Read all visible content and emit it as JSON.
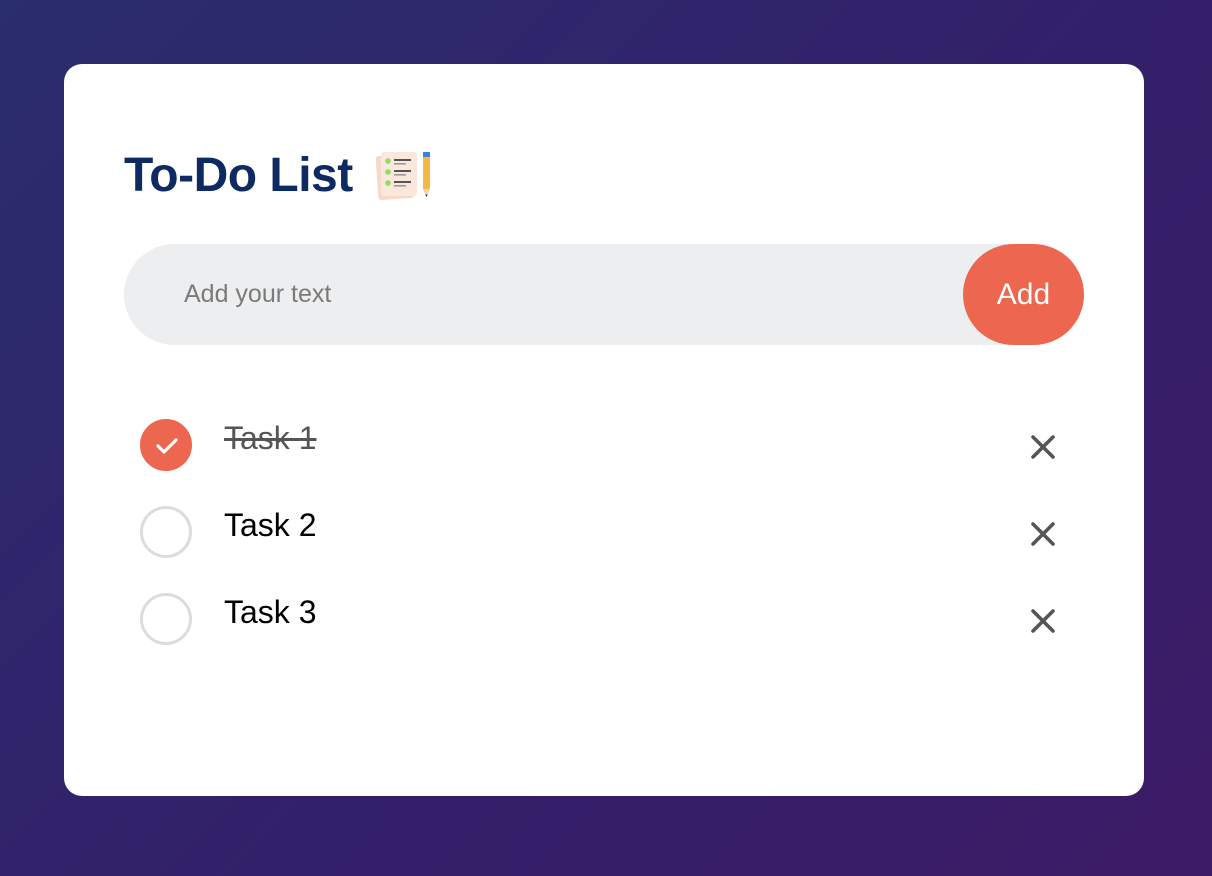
{
  "header": {
    "title": "To-Do List",
    "icon": "checklist-notepad-pencil-icon"
  },
  "input": {
    "placeholder": "Add your text",
    "value": ""
  },
  "add_button": {
    "label": "Add"
  },
  "tasks": [
    {
      "label": "Task 1",
      "done": true
    },
    {
      "label": "Task 2",
      "done": false
    },
    {
      "label": "Task 3",
      "done": false
    }
  ],
  "icons": {
    "check": "check-icon",
    "delete": "close-icon"
  },
  "colors": {
    "accent": "#ec6650",
    "title": "#0e2a62",
    "input_bg": "#edeef0",
    "background_start": "#2a2d6e",
    "background_end": "#3c1a66"
  }
}
